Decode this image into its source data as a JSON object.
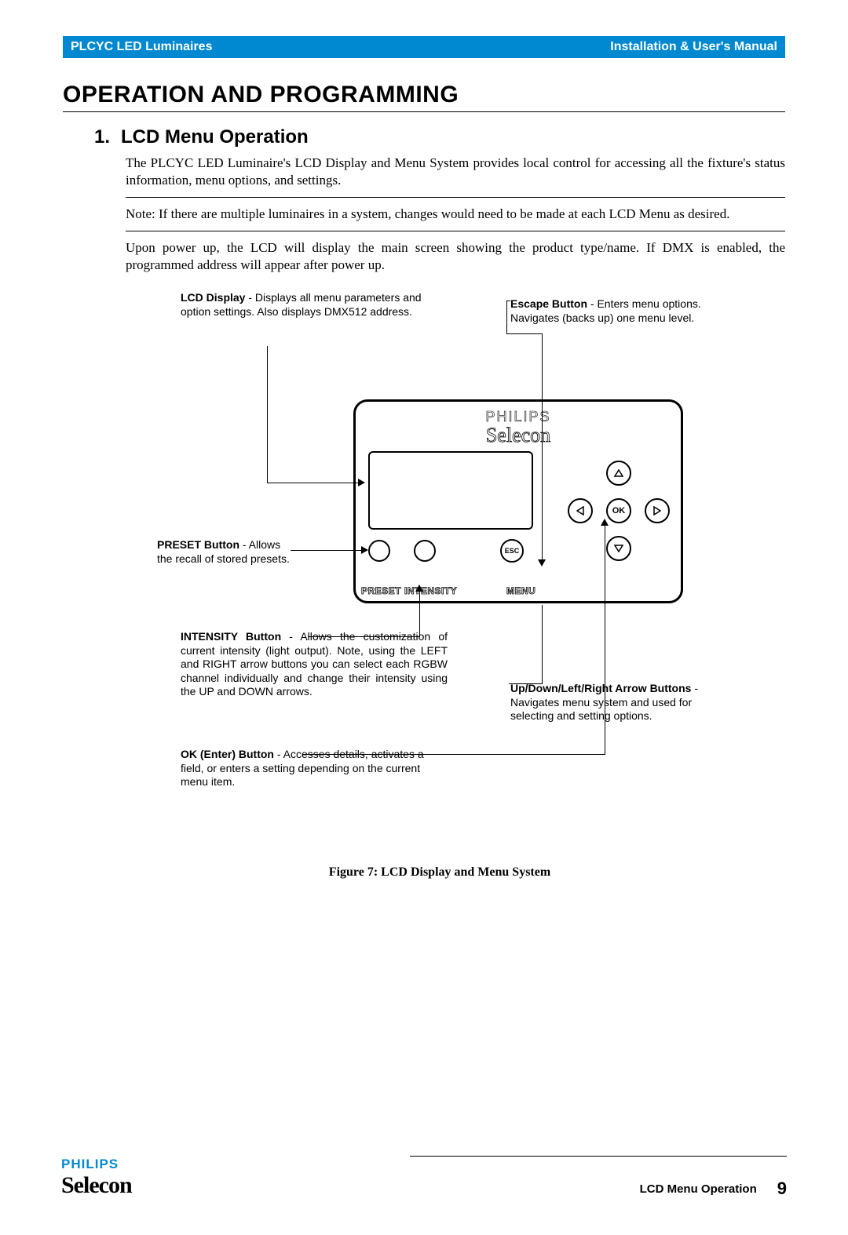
{
  "header": {
    "left": "PLCYC LED Luminaires",
    "right": "Installation & User's Manual"
  },
  "heading": "OPERATION AND PROGRAMMING",
  "section": {
    "number": "1.",
    "title": "LCD Menu Operation"
  },
  "para1": "The PLCYC LED Luminaire's LCD Display and Menu System provides local control for accessing all the fixture's status information, menu options, and settings.",
  "note": "Note:  If there are multiple luminaires in a system, changes would need to be made at each LCD Menu as desired.",
  "para2": "Upon power up, the LCD will display the main screen showing the product type/name. If DMX is enabled, the programmed address will appear after power up.",
  "callouts": {
    "lcd": {
      "label": "LCD Display",
      "text": " - Displays all menu parameters and option settings. Also displays DMX512 address."
    },
    "escape": {
      "label": "Escape Button",
      "text": " - Enters menu options. Navigates (backs up) one menu level."
    },
    "preset": {
      "label": "PRESET Button",
      "text": " - Allows the recall of stored presets."
    },
    "intensity": {
      "label": "INTENSITY Button",
      "text": " - Allows the customization of current intensity (light output). Note, using the LEFT and RIGHT arrow buttons you can select each RGBW channel individually and change their intensity using the UP and DOWN arrows."
    },
    "ok": {
      "label": "OK (Enter) Button",
      "text": " - Accesses details, activates a field, or enters a setting depending on the current menu item."
    },
    "arrows": {
      "label": "Up/Down/Left/Right Arrow Buttons",
      "text": " - Navigates menu system and used for selecting and setting options."
    }
  },
  "panel": {
    "brand1": "PHILIPS",
    "brand2": "Selecon",
    "buttons": {
      "preset": "PRESET",
      "intensity": "INTENSITY",
      "menu": "MENU",
      "esc": "ESC",
      "ok": "OK"
    }
  },
  "caption": "Figure 7:  LCD Display and Menu System",
  "footer": {
    "brand1": "PHILIPS",
    "brand2": "Selecon",
    "section": "LCD Menu Operation",
    "page": "9"
  }
}
